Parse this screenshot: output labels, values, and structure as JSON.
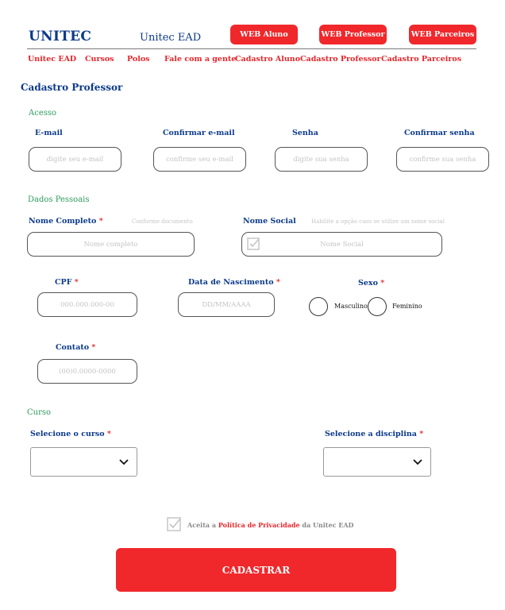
{
  "header": {
    "logo": "UNITEC",
    "subtitle": "Unitec EAD",
    "buttons": {
      "aluno": "WEB Aluno",
      "professor": "WEB Professor",
      "parceiros": "WEB Parceiros"
    }
  },
  "nav": {
    "items": [
      "Unitec EAD",
      "Cursos",
      "Polos",
      "Fale com a gente",
      "Cadastro Aluno",
      "Cadastro Professor",
      "Cadastro Parceiros"
    ]
  },
  "page": {
    "title": "Cadastro Professor"
  },
  "acesso": {
    "section": "Acesso",
    "email_label": "E-mail",
    "email_placeholder": "digite seu e-mail",
    "confirm_email_label": "Confirmar e-mail",
    "confirm_email_placeholder": "confirme seu e-mail",
    "senha_label": "Senha",
    "senha_placeholder": "digite sua senha",
    "confirm_senha_label": "Confirmar senha",
    "confirm_senha_placeholder": "confirme sua senha"
  },
  "pessoais": {
    "section": "Dados Pessoais",
    "nome_label": "Nome Completo",
    "nome_hint": "Conforme documento",
    "nome_placeholder": "Nome completo",
    "social_label": "Nome Social",
    "social_hint": "Habilite a opção caso se utilize um nome social",
    "social_placeholder": "Nome Social",
    "cpf_label": "CPF",
    "cpf_placeholder": "000.000.000-00",
    "nasc_label": "Data de Nascimento",
    "nasc_placeholder": "DD/MM/AAAA",
    "sexo_label": "Sexo",
    "masculino": "Masculino",
    "feminino": "Feminino",
    "contato_label": "Contato",
    "contato_placeholder": "(00)0.0000-0000"
  },
  "curso": {
    "section": "Curso",
    "curso_label": "Selecione o curso",
    "disciplina_label": "Selecione a disciplina"
  },
  "terms": {
    "prefix": "Aceita a",
    "link": "Política de Privacidade",
    "suffix": "da Unitec EAD"
  },
  "submit": {
    "label": "CADASTRAR"
  },
  "required_mark": "*",
  "colors": {
    "brand_blue": "#0b3a8a",
    "accent_red": "#f0282c",
    "section_green": "#2e9a5e"
  }
}
